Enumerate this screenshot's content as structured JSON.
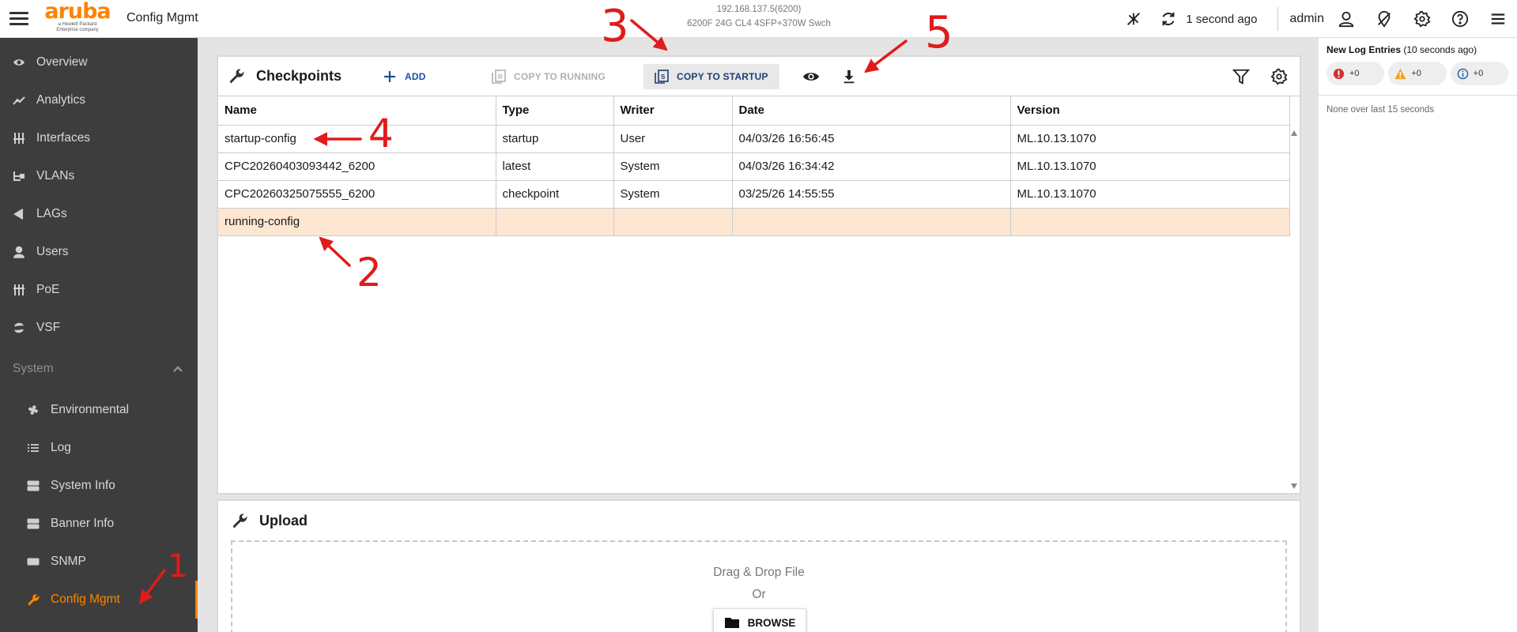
{
  "topbar": {
    "logo_word": "aruba",
    "logo_sub1": "a Hewlett Packard",
    "logo_sub2": "Enterprise company",
    "page_name": "Config Mgmt",
    "device_ip": "192.168.137.5(6200)",
    "device_model": "6200F 24G CL4 4SFP+370W Swch",
    "refresh_status": "1 second ago",
    "user": "admin"
  },
  "sidebar": {
    "items": [
      {
        "label": "Overview",
        "icon": "eye-icon"
      },
      {
        "label": "Analytics",
        "icon": "analytics-icon"
      },
      {
        "label": "Interfaces",
        "icon": "interfaces-icon"
      },
      {
        "label": "VLANs",
        "icon": "vlans-icon"
      },
      {
        "label": "LAGs",
        "icon": "share-icon"
      },
      {
        "label": "Users",
        "icon": "user-icon"
      },
      {
        "label": "PoE",
        "icon": "poe-icon"
      },
      {
        "label": "VSF",
        "icon": "sync-icon"
      }
    ],
    "section": "System",
    "sub_items": [
      {
        "label": "Environmental",
        "icon": "fan-icon"
      },
      {
        "label": "Log",
        "icon": "list-icon"
      },
      {
        "label": "System Info",
        "icon": "server-icon"
      },
      {
        "label": "Banner Info",
        "icon": "server-icon"
      },
      {
        "label": "SNMP",
        "icon": "snmp-icon"
      },
      {
        "label": "Config Mgmt",
        "icon": "wrench-icon",
        "active": true
      }
    ]
  },
  "checkpoints": {
    "title": "Checkpoints",
    "add_label": "ADD",
    "copy_running_label": "COPY TO RUNNING",
    "copy_startup_label": "COPY TO STARTUP",
    "columns": [
      "Name",
      "Type",
      "Writer",
      "Date",
      "Version"
    ],
    "rows": [
      [
        "startup-config",
        "startup",
        "User",
        "04/03/26 16:56:45",
        "ML.10.13.1070"
      ],
      [
        "CPC20260403093442_6200",
        "latest",
        "System",
        "04/03/26 16:34:42",
        "ML.10.13.1070"
      ],
      [
        "CPC20260325075555_6200",
        "checkpoint",
        "System",
        "03/25/26 14:55:55",
        "ML.10.13.1070"
      ],
      [
        "running-config",
        "",
        "",
        "",
        ""
      ]
    ]
  },
  "upload": {
    "title": "Upload",
    "drag_text": "Drag & Drop File",
    "or_text": "Or",
    "browse_label": "BROWSE"
  },
  "log": {
    "title": "New Log Entries",
    "age": "(10 seconds ago)",
    "error_count": "+0",
    "warning_count": "+0",
    "info_count": "+0",
    "empty_text": "None over last 15 seconds"
  },
  "annotations": [
    "1",
    "2",
    "3",
    "4",
    "5"
  ],
  "colors": {
    "accent": "#ff8300",
    "sidebar_bg": "#3d3d3d",
    "highlight_row": "#fde6d2",
    "annotation": "#e01b1b",
    "link_blue": "#1b4f9c"
  }
}
